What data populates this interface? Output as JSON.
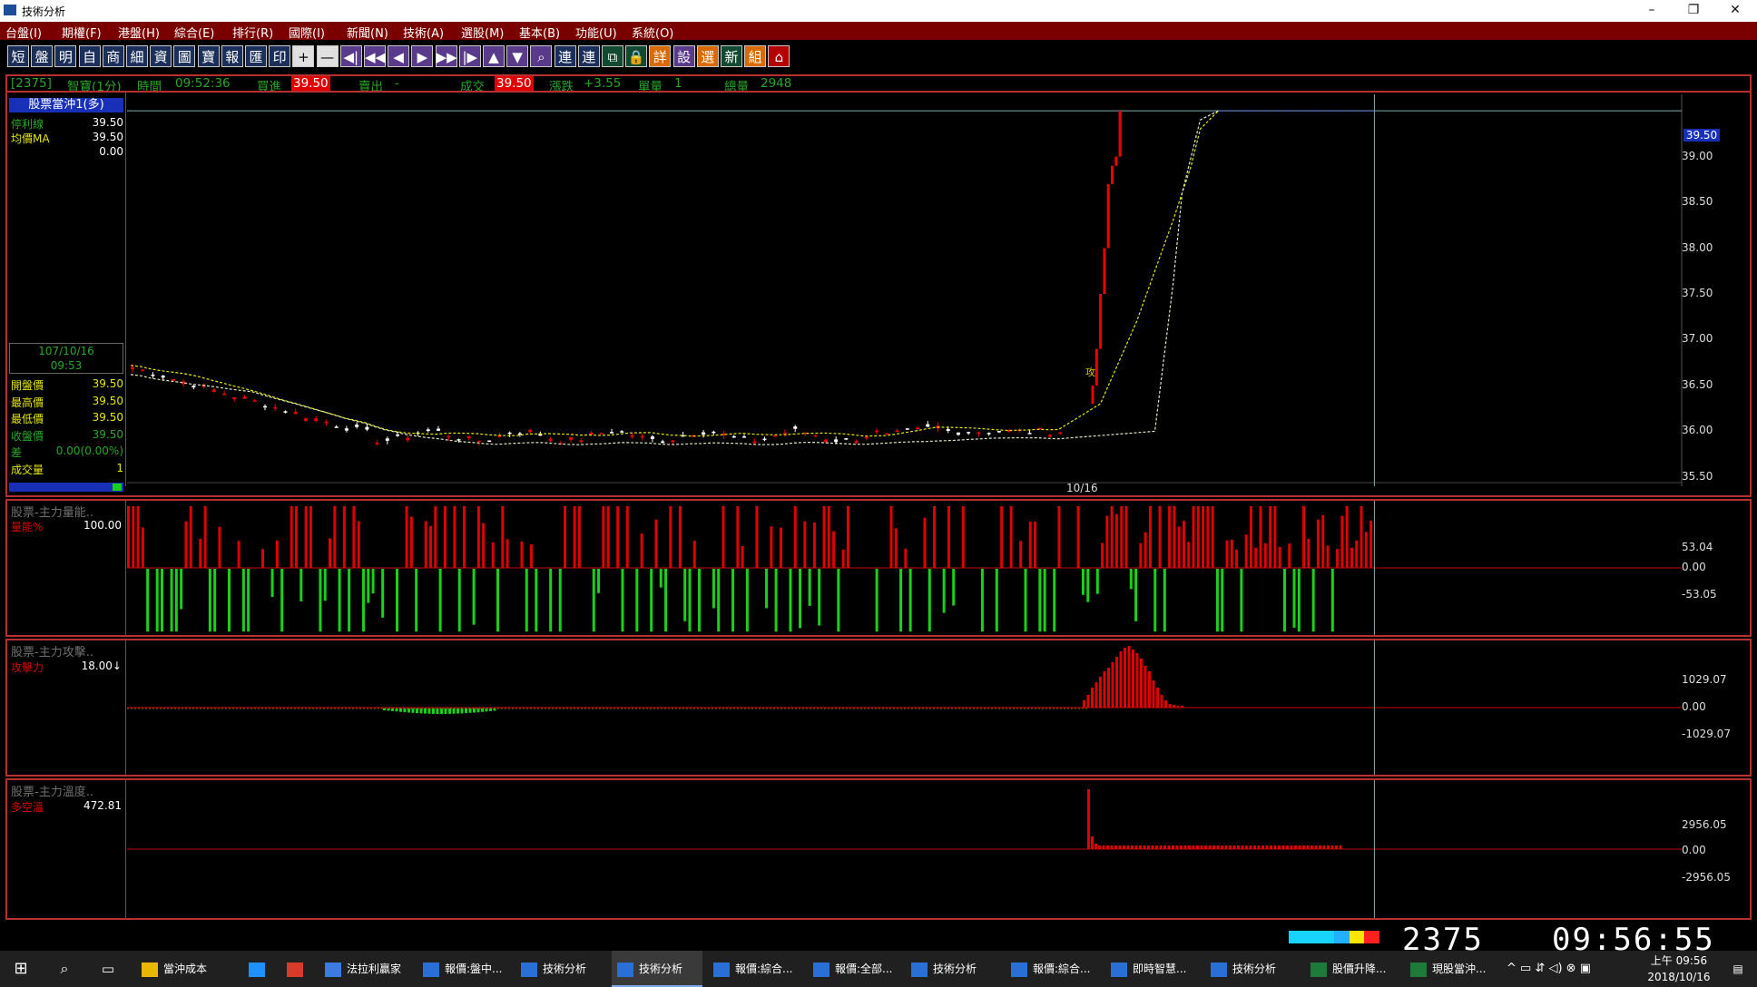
{
  "window": {
    "title": "技術分析",
    "controls": [
      "–",
      "❐",
      "✕"
    ]
  },
  "menu": [
    "台盤(I)",
    "期權(F)",
    "港盤(H)",
    "綜合(E)",
    "排行(R)",
    "國際(I)",
    "新聞(N)",
    "技術(A)",
    "選股(M)",
    "基本(B)",
    "功能(U)",
    "系統(O)"
  ],
  "toolbar": {
    "buttons": [
      {
        "label": "短",
        "icon": "short-term-icon"
      },
      {
        "label": "盤",
        "icon": "quote-board-icon"
      },
      {
        "label": "明",
        "icon": "detail-icon"
      },
      {
        "label": "自",
        "icon": "self-select-icon"
      },
      {
        "label": "商",
        "icon": "commodity-icon"
      },
      {
        "label": "細",
        "icon": "tick-detail-icon"
      },
      {
        "label": "資",
        "icon": "info-icon"
      },
      {
        "label": "圖",
        "icon": "chart-icon"
      },
      {
        "label": "寶",
        "icon": "treasure-icon"
      },
      {
        "label": "報",
        "icon": "report-icon"
      },
      {
        "label": "匯",
        "icon": "exchange-icon"
      },
      {
        "label": "印",
        "icon": "print-icon"
      },
      {
        "label": "+",
        "icon": "zoom-in-icon"
      },
      {
        "label": "—",
        "icon": "zoom-out-icon"
      },
      {
        "label": "◀|",
        "icon": "first-icon"
      },
      {
        "label": "◀◀",
        "icon": "rewind-icon"
      },
      {
        "label": "◀",
        "icon": "prev-icon"
      },
      {
        "label": "▶",
        "icon": "next-icon"
      },
      {
        "label": "▶▶",
        "icon": "fast-forward-icon"
      },
      {
        "label": "|▶",
        "icon": "last-icon"
      },
      {
        "label": "▲",
        "icon": "up-icon"
      },
      {
        "label": "▼",
        "icon": "down-icon"
      },
      {
        "label": "⌕",
        "icon": "search-icon"
      },
      {
        "label": "連",
        "icon": "link-icon"
      },
      {
        "label": "連",
        "icon": "link2-icon"
      },
      {
        "label": "⧉",
        "icon": "window-icon"
      },
      {
        "label": "🔒",
        "icon": "lock-icon"
      },
      {
        "label": "詳",
        "icon": "detail2-icon"
      },
      {
        "label": "設",
        "icon": "settings-icon"
      },
      {
        "label": "選",
        "icon": "select-icon"
      },
      {
        "label": "新",
        "icon": "new-icon"
      },
      {
        "label": "組",
        "icon": "group-icon"
      },
      {
        "label": "⌂",
        "icon": "home-icon"
      }
    ]
  },
  "quote_bar": {
    "code": "[2375]",
    "name": "智寶(1分)",
    "time_label": "時間",
    "time": "09:52:36",
    "bid_label": "買進",
    "bid": "39.50",
    "ask_label": "賣出",
    "ask": "-",
    "last_label": "成交",
    "last": "39.50",
    "change_label": "漲跌",
    "change": "+3.55",
    "vol_label": "單量",
    "vol": "1",
    "total_label": "總量",
    "total": "2948"
  },
  "main_panel": {
    "title": "股票當沖1(多)",
    "indicators": [
      {
        "name": "停利線",
        "value": "39.50",
        "color": "#2aa52a"
      },
      {
        "name": "均價MA",
        "value": "39.50",
        "color": "#e6e600"
      },
      {
        "name": "",
        "value": "0.00",
        "color": "#ffffff"
      }
    ],
    "date": "107/10/16",
    "time": "09:53",
    "ohlc": [
      {
        "name": "開盤價",
        "value": "39.50",
        "color": "#e6e600"
      },
      {
        "name": "最高價",
        "value": "39.50",
        "color": "#e6e600"
      },
      {
        "name": "最低價",
        "value": "39.50",
        "color": "#e6e600"
      },
      {
        "name": "收盤價",
        "value": "39.50",
        "color": "#2aa52a"
      },
      {
        "name": "差",
        "value": "0.00(0.00%)",
        "color": "#2aa52a"
      },
      {
        "name": "成交量",
        "value": "1",
        "color": "#e6e600"
      }
    ],
    "x_label": "10/16",
    "price_tag": "39.50",
    "marker": "攻"
  },
  "volume_panel": {
    "title": "股票-主力量能..",
    "series": "量能%",
    "value": "100.00"
  },
  "attack_panel": {
    "title": "股票-主力攻擊..",
    "series": "攻擊力",
    "value": "18.00↓"
  },
  "temp_panel": {
    "title": "股票-主力溫度..",
    "series": "多空溫",
    "value": "472.81"
  },
  "chart_data": [
    {
      "type": "candlestick",
      "title": "股票當沖1(多)",
      "x_label": "10/16",
      "y_ticks": [
        "39.00",
        "38.50",
        "38.00",
        "37.50",
        "37.00",
        "36.50",
        "36.00",
        "35.50"
      ],
      "ylim": [
        35.4,
        39.6
      ],
      "series": [
        {
          "name": "停利線"
        },
        {
          "name": "均價MA"
        }
      ],
      "current_price": 39.5,
      "phases": [
        {
          "from_bar": 0,
          "to_bar": 90,
          "level_start": 36.7,
          "level_mid": 35.85,
          "level_end": 36.0
        },
        {
          "from_bar": 90,
          "to_bar": 100,
          "surge_to": 39.5
        }
      ]
    },
    {
      "type": "bar",
      "title": "股票-主力量能..",
      "series": [
        {
          "name": "量能%"
        }
      ],
      "y_ticks": [
        "53.04",
        "0.00",
        "-53.05"
      ],
      "ylim": [
        -53.05,
        53.04
      ]
    },
    {
      "type": "bar",
      "title": "股票-主力攻擊..",
      "series": [
        {
          "name": "攻擊力"
        }
      ],
      "y_ticks": [
        "1029.07",
        "0.00",
        "-1029.07"
      ],
      "ylim": [
        -1029.07,
        1029.07
      ]
    },
    {
      "type": "bar",
      "title": "股票-主力溫度..",
      "series": [
        {
          "name": "多空溫"
        }
      ],
      "y_ticks": [
        "2956.05",
        "0.00",
        "-2956.05"
      ],
      "ylim": [
        -2956.05,
        2956.05
      ]
    }
  ],
  "status_strip": {
    "code": "2375",
    "clock": "09:56:55"
  },
  "taskbar": {
    "items": [
      {
        "label": "當沖成本",
        "icon": "folder-icon"
      },
      {
        "label": "",
        "icon": "ie-icon"
      },
      {
        "label": "",
        "icon": "chrome-icon"
      },
      {
        "label": "法拉利贏家",
        "icon": "app-icon"
      },
      {
        "label": "報價:盤中...",
        "icon": "chart-app-icon"
      },
      {
        "label": "技術分析",
        "icon": "chart-app-icon"
      },
      {
        "label": "技術分析",
        "icon": "chart-app-icon"
      },
      {
        "label": "報價:綜合...",
        "icon": "chart-app-icon"
      },
      {
        "label": "報價:全部...",
        "icon": "chart-app-icon"
      },
      {
        "label": "技術分析",
        "icon": "chart-app-icon"
      },
      {
        "label": "報價:綜合...",
        "icon": "chart-app-icon"
      },
      {
        "label": "即時智慧...",
        "icon": "chart-app-icon"
      },
      {
        "label": "技術分析",
        "icon": "chart-app-icon"
      },
      {
        "label": "股價升降...",
        "icon": "excel-icon"
      },
      {
        "label": "現股當沖...",
        "icon": "excel-icon"
      }
    ],
    "clock_time": "上午 09:56",
    "clock_date": "2018/10/16"
  }
}
